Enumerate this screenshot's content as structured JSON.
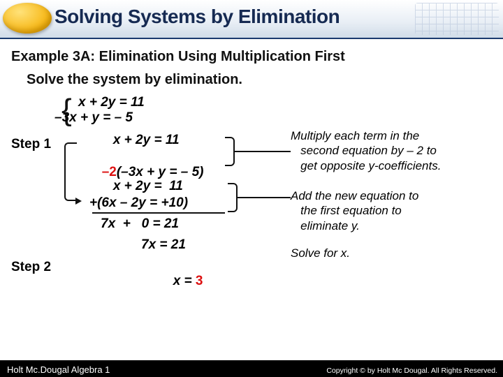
{
  "header": {
    "title": "Solving Systems by Elimination"
  },
  "example_title": "Example 3A: Elimination Using Multiplication First",
  "instruction": "Solve the system by elimination.",
  "system": {
    "eq1": "x + 2y = 11",
    "eq2": "–3x + y = – 5"
  },
  "steps": {
    "s1": "Step 1",
    "s2": "Step 2",
    "l1": "   x + 2y = 11",
    "l2a": "–2",
    "l2b": "(–3x + y = – 5)",
    "l3": "   x + 2y =  11",
    "l4": "+(6x – 2y = +10)",
    "l5": "7x  +   0 = 21",
    "l6": "7x = 21",
    "l7a": "x = ",
    "l7b": "3"
  },
  "notes": {
    "n1a": "Multiply each term in the",
    "n1b": "second equation by – 2 to",
    "n1c": "get opposite y-coefficients.",
    "n2a": "Add the new equation to",
    "n2b": "the first equation to",
    "n2c": "eliminate y.",
    "n3": "Solve for x."
  },
  "footer": {
    "left": "Holt Mc.Dougal Algebra 1",
    "right": "Copyright © by Holt Mc Dougal. All Rights Reserved."
  }
}
